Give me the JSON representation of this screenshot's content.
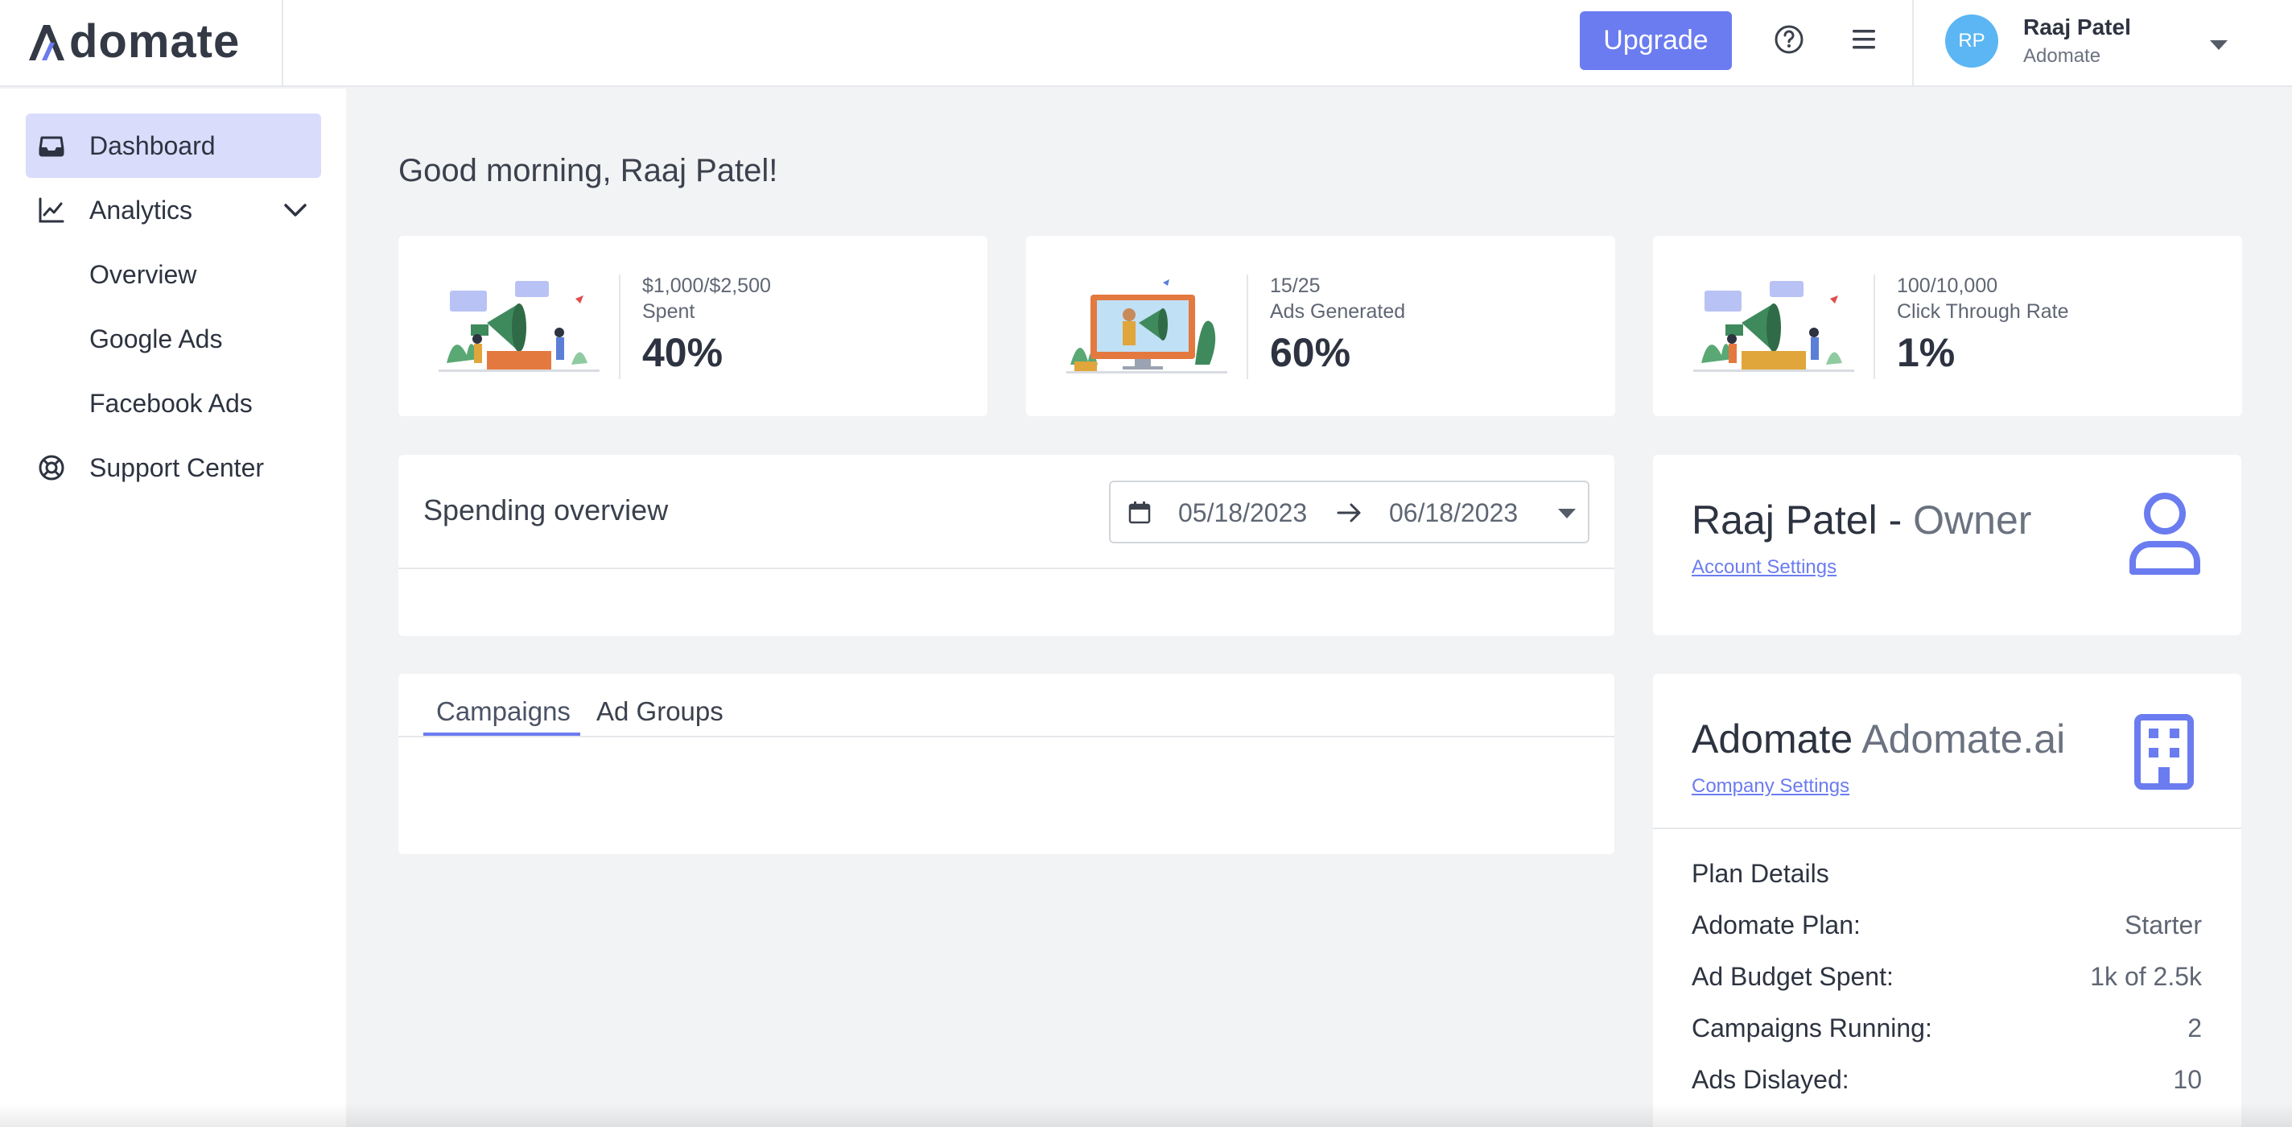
{
  "header": {
    "logo_text": "domate",
    "upgrade_label": "Upgrade",
    "user": {
      "initials": "RP",
      "name": "Raaj Patel",
      "org": "Adomate"
    }
  },
  "sidebar": {
    "items": [
      {
        "label": "Dashboard",
        "icon": "inbox-icon",
        "active": true
      },
      {
        "label": "Analytics",
        "icon": "line-chart-icon",
        "expanded": true,
        "children": [
          "Overview",
          "Google Ads",
          "Facebook Ads"
        ]
      },
      {
        "label": "Support Center",
        "icon": "lifebuoy-icon"
      }
    ]
  },
  "main": {
    "greeting": "Good morning, Raaj Patel!",
    "stats": [
      {
        "fraction": "$1,000/$2,500",
        "label": "Spent",
        "percent": "40%"
      },
      {
        "fraction": "15/25",
        "label": "Ads Generated",
        "percent": "60%"
      },
      {
        "fraction": "100/10,000",
        "label": "Click Through Rate",
        "percent": "1%"
      }
    ],
    "spending": {
      "title": "Spending overview",
      "date_start": "05/18/2023",
      "date_end": "06/18/2023"
    },
    "tabs": [
      {
        "label": "Campaigns",
        "active": true
      },
      {
        "label": "Ad Groups"
      }
    ]
  },
  "owner": {
    "name": "Raaj Patel",
    "separator": " - ",
    "role": "Owner",
    "settings_link": "Account Settings"
  },
  "company": {
    "name": "Adomate",
    "domain": "Adomate.ai",
    "settings_link": "Company Settings",
    "plan_heading": "Plan Details",
    "plan_rows": [
      {
        "key": "Adomate Plan:",
        "value": "Starter"
      },
      {
        "key": "Ad Budget Spent:",
        "value": "1k of 2.5k"
      },
      {
        "key": "Campaigns Running:",
        "value": "2"
      },
      {
        "key": "Ads Dislayed:",
        "value": "10"
      }
    ]
  },
  "colors": {
    "accent": "#6b7cf0",
    "active_nav": "#d9dcfb",
    "avatar": "#5bb6f3",
    "background": "#f2f3f5"
  }
}
